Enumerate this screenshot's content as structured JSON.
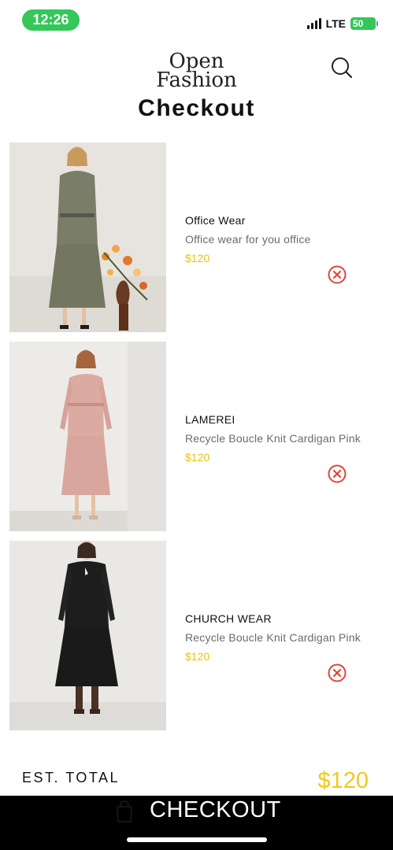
{
  "status_bar": {
    "time": "12:26",
    "network": "LTE",
    "battery": "50"
  },
  "header": {
    "logo_line1": "Open",
    "logo_line2": "Fashion",
    "icons": {
      "search": "search-icon"
    }
  },
  "page": {
    "title": "Checkout"
  },
  "items": [
    {
      "name": "Office Wear",
      "description": "Office wear for you office",
      "price": "$120",
      "image": "olive-green-dress-photo"
    },
    {
      "name": "LAMEREI",
      "description": "Recycle Boucle Knit Cardigan Pink",
      "price": "$120",
      "image": "pink-dress-photo"
    },
    {
      "name": "CHURCH WEAR",
      "description": "Recycle Boucle Knit Cardigan Pink",
      "price": "$120",
      "image": "black-dress-photo"
    }
  ],
  "summary": {
    "total_label": "EST. TOTAL",
    "total_value": "$120"
  },
  "checkout": {
    "label": "CHECKOUT",
    "icon": "shopping-bag-icon"
  },
  "colors": {
    "price": "#e8c21a",
    "total": "#f2c91a",
    "remove": "#e0453a",
    "checkout_bar": "#000000",
    "status_green": "#34c759"
  }
}
